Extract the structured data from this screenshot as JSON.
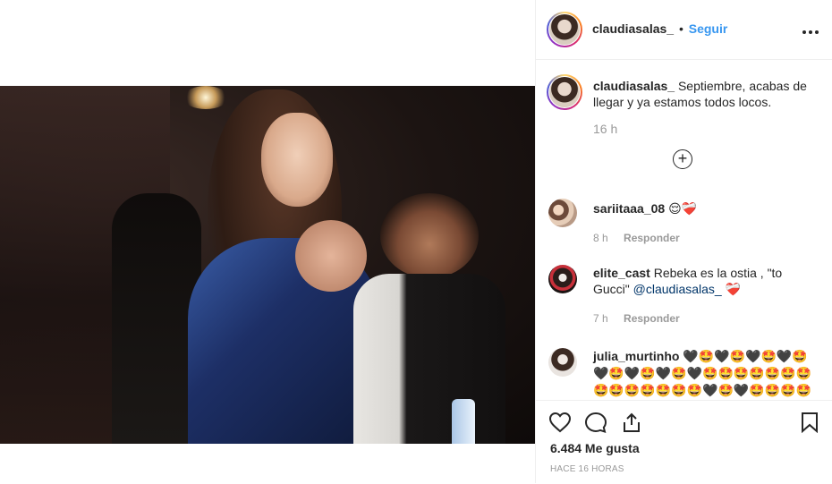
{
  "post": {
    "username": "claudiasalas_",
    "follow_separator": "•",
    "follow_label": "Seguir",
    "more_icon": "more-options-icon"
  },
  "caption": {
    "username": "claudiasalas_",
    "text": "Septiembre, acabas de llegar y ya estamos todos locos.",
    "time": "16 h"
  },
  "comments": [
    {
      "username": "sariitaaa_08",
      "text": "😌❤️‍🩹",
      "time": "8 h",
      "reply": "Responder"
    },
    {
      "username": "elite_cast",
      "text": "Rebeka es la ostia , \"to Gucci\"",
      "mention": "@claudiasalas_",
      "emoji": "❤️‍🩹",
      "time": "7 h",
      "reply": "Responder"
    },
    {
      "username": "julia_murtinho",
      "text": "🖤🤩🖤🤩🖤🤩🖤🤩🖤🤩🖤🤩🖤🤩🖤🤩🤩🤩🤩🤩🤩🤩🤩🤩🤩🤩🤩🤩🤩🖤🤩🖤🤩🤩🤩🤩"
    }
  ],
  "actions": {
    "like_icon": "heart-icon",
    "comment_icon": "comment-icon",
    "share_icon": "share-icon",
    "save_icon": "bookmark-icon"
  },
  "likes": "6.484 Me gusta",
  "timestamp": "HACE 16 HORAS"
}
